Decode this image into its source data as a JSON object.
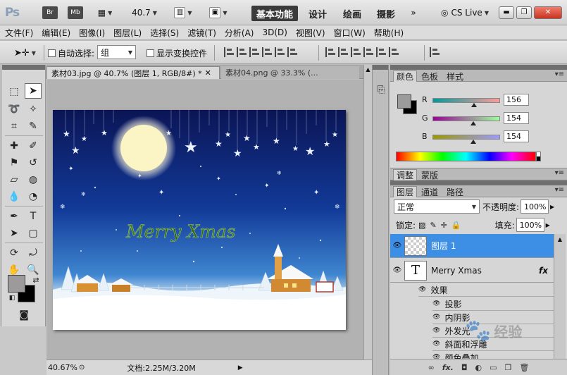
{
  "appbar": {
    "logo": "Ps",
    "br": "Br",
    "mb": "Mb",
    "zoom": "40.7",
    "workspaces": [
      "基本功能",
      "设计",
      "绘画",
      "摄影"
    ],
    "cs_live": "CS Live"
  },
  "menubar": {
    "items": [
      "文件(F)",
      "编辑(E)",
      "图像(I)",
      "图层(L)",
      "选择(S)",
      "滤镜(T)",
      "分析(A)",
      "3D(D)",
      "视图(V)",
      "窗口(W)",
      "帮助(H)"
    ]
  },
  "options": {
    "auto_select_label": "自动选择:",
    "auto_select_value": "组",
    "show_transform_label": "显示变换控件"
  },
  "document": {
    "tabs": [
      "素材03.jpg @ 40.7% (图层 1, RGB/8#) *",
      "素材04.png @ 33.3% (..."
    ],
    "canvas_text": "Merry Xmas",
    "zoom_status": "40.67%",
    "doc_info": "文档:2.25M/3.20M"
  },
  "color_panel": {
    "tabs": [
      "颜色",
      "色板",
      "样式"
    ],
    "channels": [
      {
        "label": "R",
        "value": "156",
        "fraction": 0.61,
        "gradient": "linear-gradient(to right,#009a9a,#ff9a9a)"
      },
      {
        "label": "G",
        "value": "154",
        "fraction": 0.6,
        "gradient": "linear-gradient(to right,#9c009a,#9cff9a)"
      },
      {
        "label": "B",
        "value": "154",
        "fraction": 0.6,
        "gradient": "linear-gradient(to right,#9c9a00,#9c9aff)"
      }
    ],
    "foreground": "#9c9a9a",
    "background": "#000000"
  },
  "adjust_tabs": [
    "调整",
    "蒙版"
  ],
  "layers_panel": {
    "tabs": [
      "图层",
      "通道",
      "路径"
    ],
    "blend_mode": "正常",
    "opacity_label": "不透明度:",
    "opacity": "100%",
    "lock_label": "锁定:",
    "fill_label": "填充:",
    "fill": "100%",
    "layers": [
      {
        "name": "图层 1"
      },
      {
        "name": "Merry Xmas",
        "fx": "fx"
      }
    ],
    "effects_label": "效果",
    "effects": [
      "投影",
      "内阴影",
      "外发光",
      "斜面和浮雕",
      "颜色叠加"
    ]
  },
  "watermark": "经验"
}
